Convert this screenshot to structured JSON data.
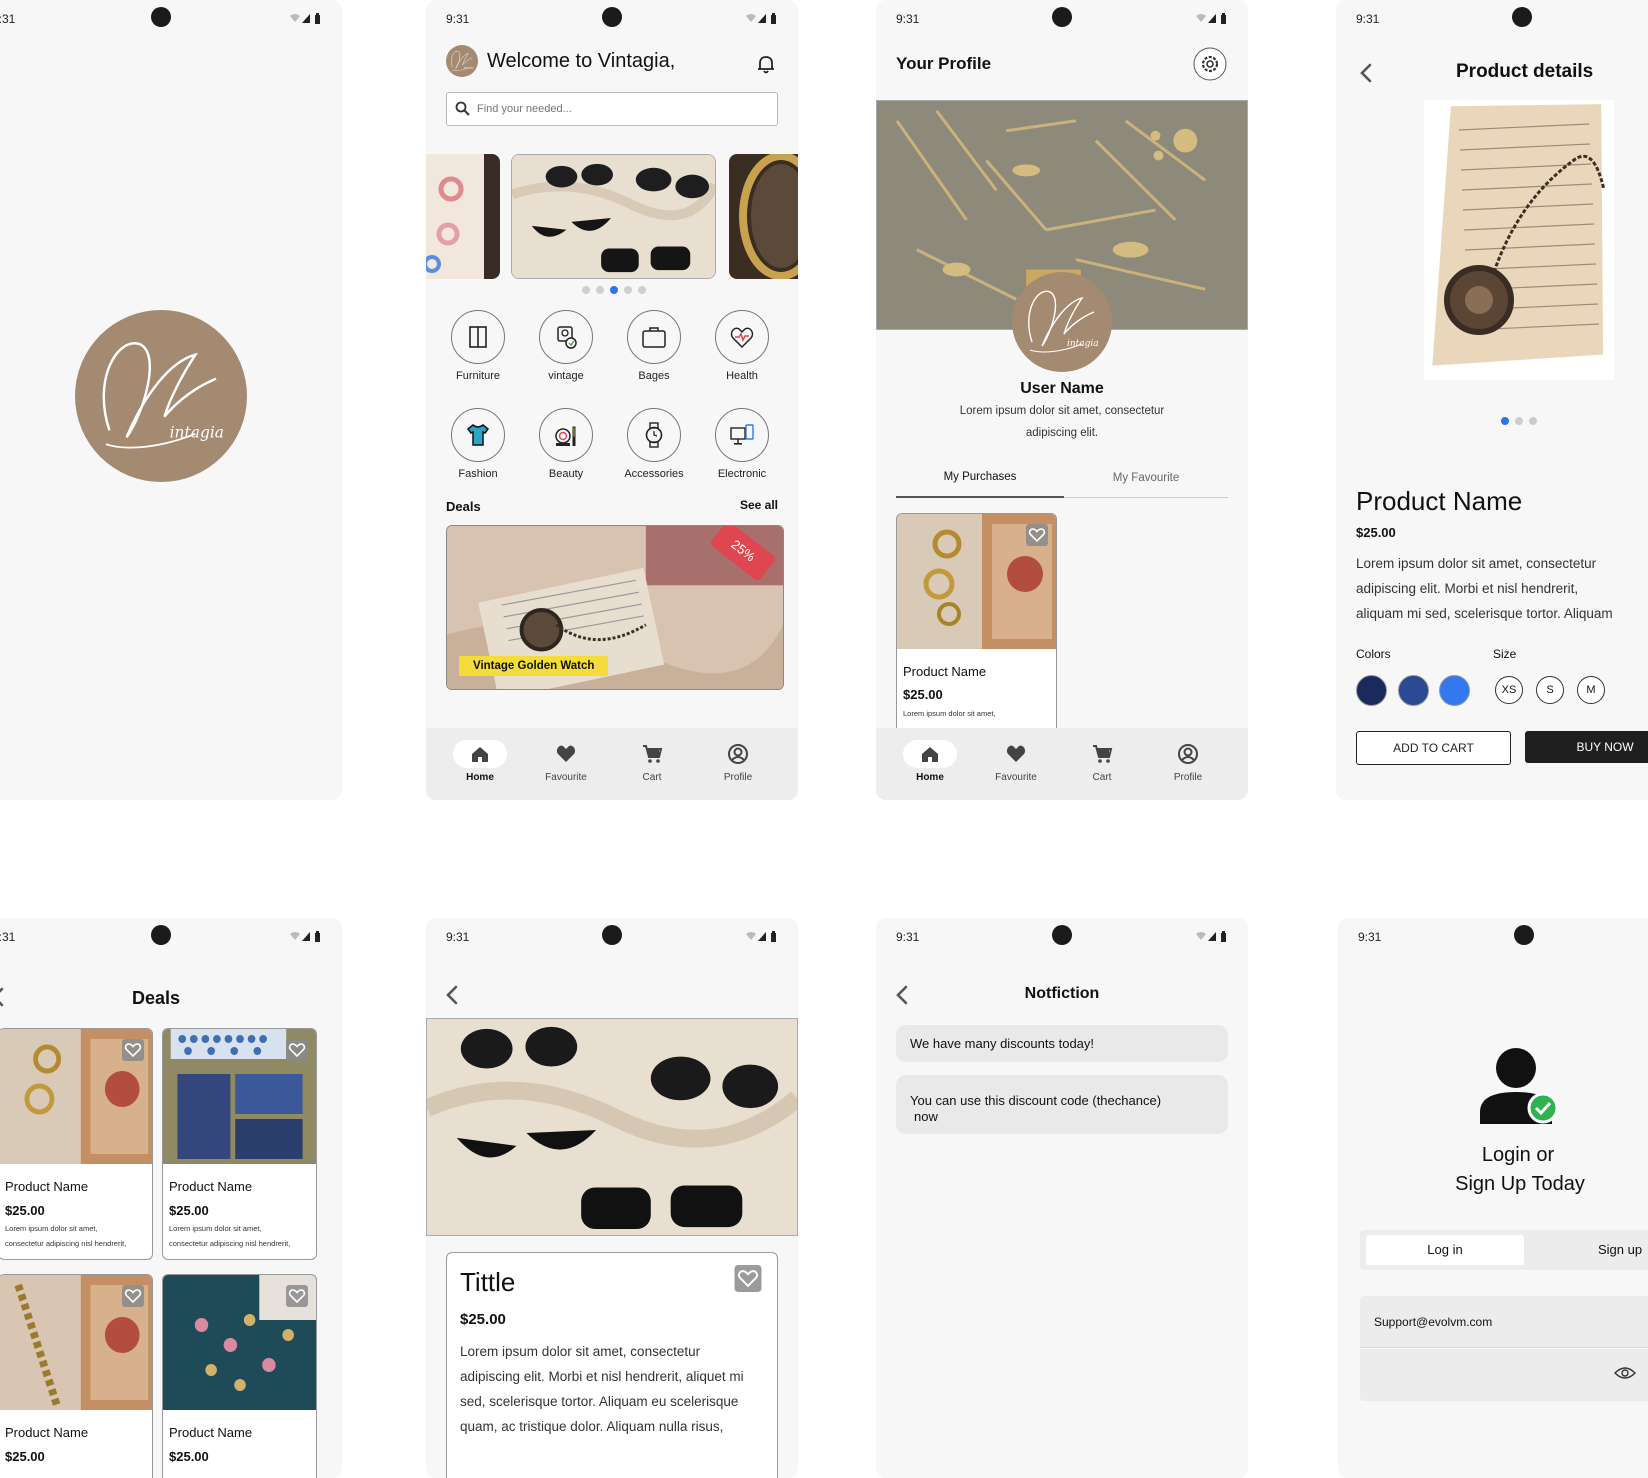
{
  "status": {
    "time": "9:31"
  },
  "colors": {
    "brand": "#a58a72",
    "accent_blue": "#2f74e6",
    "dark_navy": "#1b2a5c",
    "mid_blue": "#2a4a93",
    "bright_blue": "#3478f0",
    "dark_button": "#1f1f1f",
    "tag_red": "#e0464f",
    "highlight": "#f4dd3b",
    "check_green": "#2eb34f"
  },
  "splash": {
    "logo_text": "intagia"
  },
  "home": {
    "greeting": "Welcome to Vintagia,",
    "search_placeholder": "Find your needed...",
    "categories": [
      {
        "label": "Furniture",
        "icon": "cabinet-icon"
      },
      {
        "label": "vintage",
        "icon": "vintage-icon"
      },
      {
        "label": "Bages",
        "icon": "bag-icon"
      },
      {
        "label": "Health",
        "icon": "health-heart-icon"
      },
      {
        "label": "Fashion",
        "icon": "tshirt-icon"
      },
      {
        "label": "Beauty",
        "icon": "beauty-icon"
      },
      {
        "label": "Accessories",
        "icon": "watch-icon"
      },
      {
        "label": "Electronic",
        "icon": "devices-icon"
      }
    ],
    "deals_title": "Deals",
    "see_all": "See all",
    "deal_tag": "25%",
    "deal_label": "Vintage Golden Watch",
    "carousel_active_dot": 2
  },
  "profile": {
    "title": "Your Profile",
    "user_name": "User Name",
    "bio_line1": "Lorem ipsum dolor sit amet, consectetur",
    "bio_line2": "adipiscing elit.",
    "tabs": [
      "My Purchases",
      "My Favourite"
    ],
    "card": {
      "name": "Product Name",
      "price": "$25.00",
      "desc": "Lorem ipsum dolor sit amet,"
    }
  },
  "nav": {
    "items": [
      "Home",
      "Favourite",
      "Cart",
      "Profile"
    ]
  },
  "details": {
    "title": "Product details",
    "name": "Product Name",
    "price": "$25.00",
    "desc1": "Lorem ipsum dolor sit amet, consectetur",
    "desc2": "adipiscing elit. Morbi et nisl hendrerit,",
    "desc3": "aliquam mi sed, scelerisque tortor. Aliquam",
    "colors_label": "Colors",
    "size_label": "Size",
    "sizes": [
      "XS",
      "S",
      "M"
    ],
    "add_to_cart": "ADD TO CART",
    "buy_now": "BUY NOW"
  },
  "deals": {
    "title": "Deals",
    "items": [
      {
        "name": "Product Name",
        "price": "$25.00",
        "desc1": "Lorem ipsum dolor sit amet,",
        "desc2": "consectetur adipiscing nisl hendrerit,"
      },
      {
        "name": "Product Name",
        "price": "$25.00",
        "desc1": "Lorem ipsum dolor sit amet,",
        "desc2": "consectetur adipiscing nisl hendrerit,"
      },
      {
        "name": "Product Name",
        "price": "$25.00"
      },
      {
        "name": "Product Name",
        "price": "$25.00"
      }
    ]
  },
  "item": {
    "title": "Tittle",
    "price": "$25.00",
    "line1": "Lorem ipsum dolor sit amet, consectetur",
    "line2": "adipiscing elit. Morbi et nisl hendrerit, aliquet mi",
    "line3": "sed, scelerisque tortor. Aliquam eu scelerisque",
    "line4": "quam, ac tristique dolor. Aliquam nulla risus,"
  },
  "notifications": {
    "title": "Notfiction",
    "msg1": "We have many discounts today!",
    "msg2a": "You can use this discount code (thechance)",
    "msg2b": "now"
  },
  "login": {
    "heading1": "Login or",
    "heading2": "Sign Up Today",
    "tab_login": "Log in",
    "tab_signup": "Sign up",
    "email_value": "Support@evolvm.com"
  }
}
